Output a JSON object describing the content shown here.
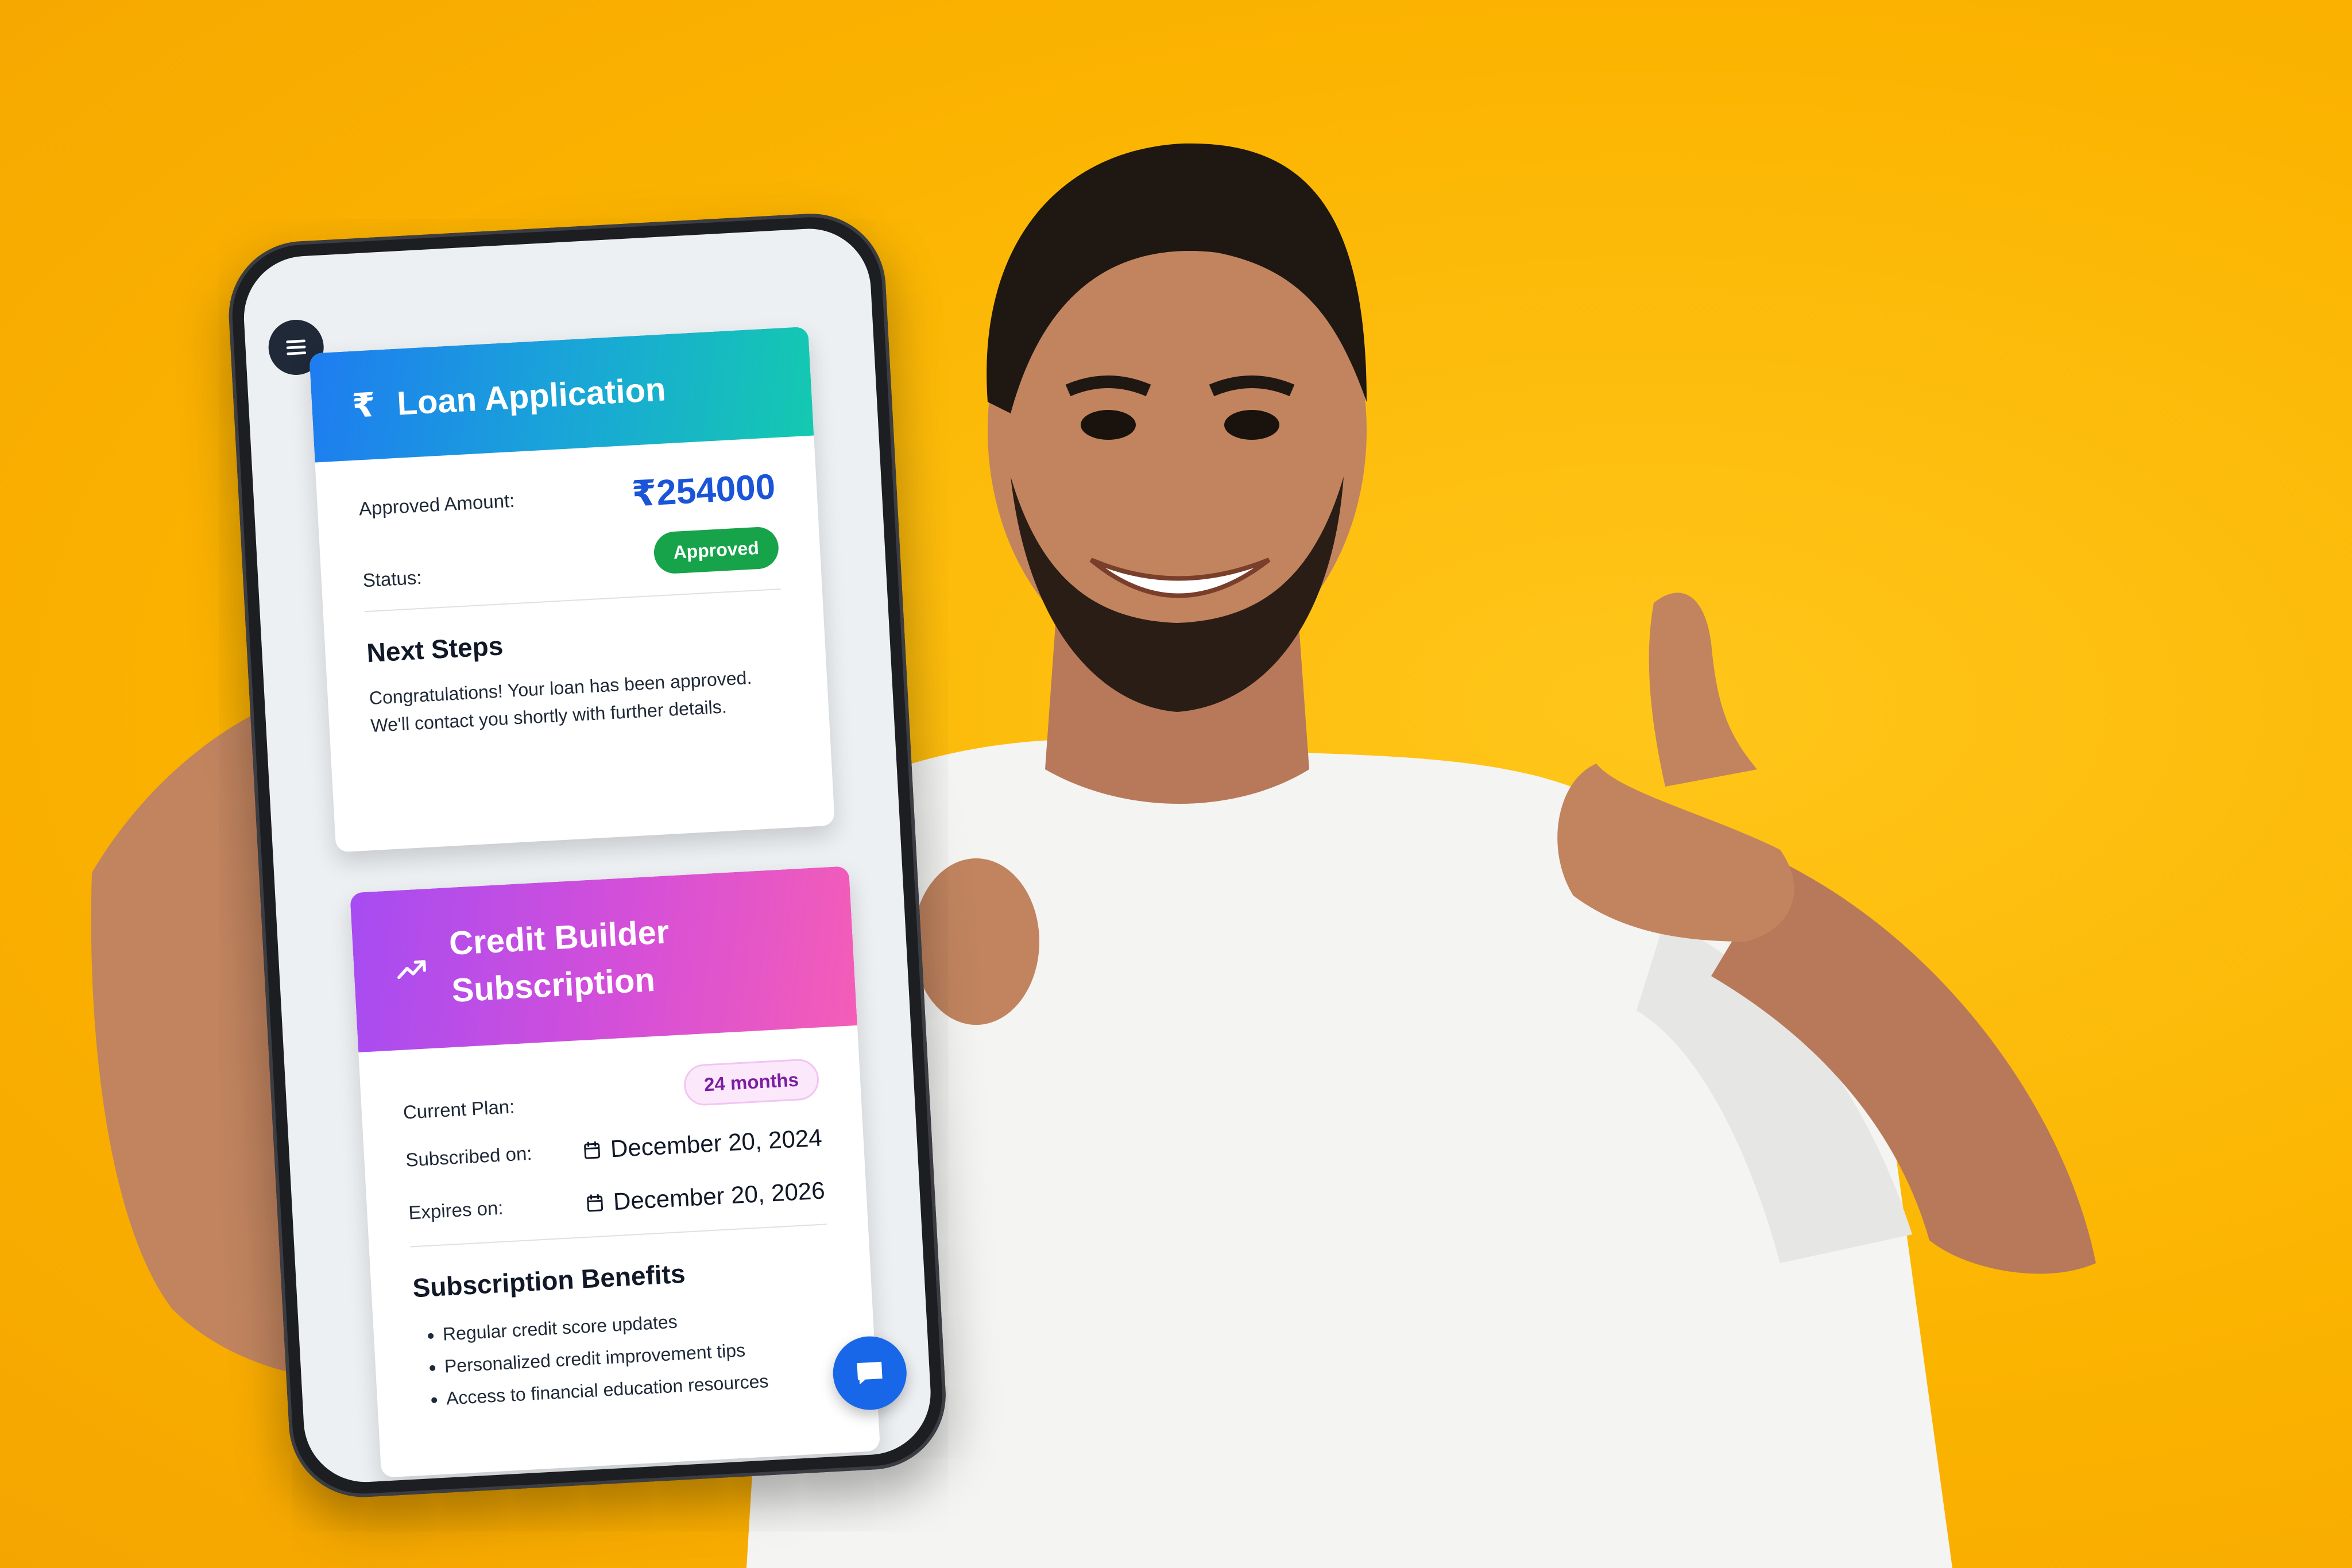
{
  "colors": {
    "background": "#fbb400",
    "loan_header_gradient": [
      "#1e7cf0",
      "#14c9b0"
    ],
    "credit_header_gradient": [
      "#a64cf2",
      "#f45db7"
    ],
    "amount": "#1a54d8",
    "approved_badge": "#16a34a",
    "months_badge_text": "#7b1fa2",
    "chat_button": "#1767e8"
  },
  "icons": {
    "menu": "hamburger-icon",
    "loan": "rupee-icon",
    "credit": "trending-up-icon",
    "date": "calendar-icon",
    "chat": "chat-bubble-icon"
  },
  "loan": {
    "title": "Loan Application",
    "approved_label": "Approved Amount:",
    "approved_amount": "₹254000",
    "status_label": "Status:",
    "status_value": "Approved",
    "next_steps_title": "Next Steps",
    "next_steps_text": "Congratulations! Your loan has been approved. We'll contact you shortly with further details."
  },
  "credit": {
    "title": "Credit Builder Subscription",
    "plan_label": "Current Plan:",
    "plan_value": "24 months",
    "subscribed_label": "Subscribed on:",
    "subscribed_date": "December 20, 2024",
    "expires_label": "Expires on:",
    "expires_date": "December 20, 2026",
    "benefits_title": "Subscription Benefits",
    "benefits": [
      "Regular credit score updates",
      "Personalized credit improvement tips",
      "Access to financial education resources"
    ]
  }
}
